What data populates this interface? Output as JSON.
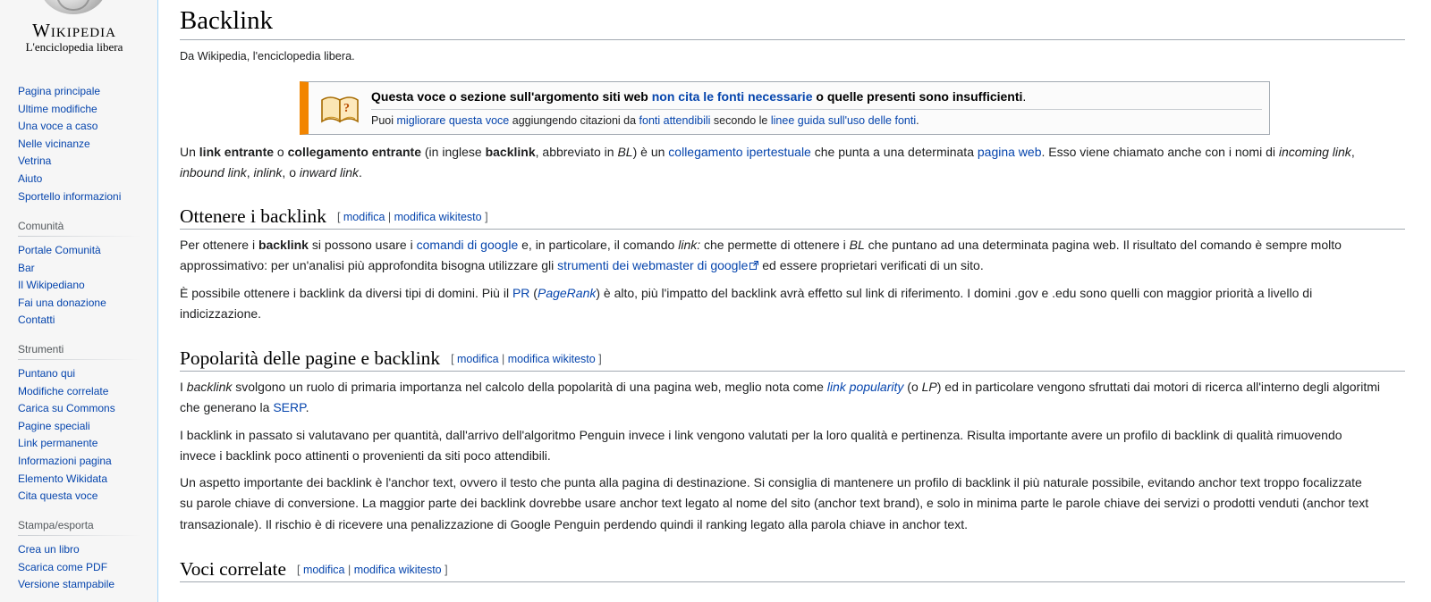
{
  "sidebar": {
    "logo": {
      "wordmark": "Wikipedia",
      "tagline": "L'enciclopedia libera"
    },
    "navigation": [
      "Pagina principale",
      "Ultime modifiche",
      "Una voce a caso",
      "Nelle vicinanze",
      "Vetrina",
      "Aiuto",
      "Sportello informazioni"
    ],
    "community": {
      "heading": "Comunità",
      "items": [
        "Portale Comunità",
        "Bar",
        "Il Wikipediano",
        "Fai una donazione",
        "Contatti"
      ]
    },
    "tools": {
      "heading": "Strumenti",
      "items": [
        "Puntano qui",
        "Modifiche correlate",
        "Carica su Commons",
        "Pagine speciali",
        "Link permanente",
        "Informazioni pagina",
        "Elemento Wikidata",
        "Cita questa voce"
      ]
    },
    "print": {
      "heading": "Stampa/esporta",
      "items": [
        "Crea un libro",
        "Scarica come PDF",
        "Versione stampabile"
      ]
    }
  },
  "article": {
    "title": "Backlink",
    "site_sub": "Da Wikipedia, l'enciclopedia libera.",
    "ambox": {
      "l1_a": "Questa voce o sezione sull'argomento siti web ",
      "l1_link": "non cita le fonti necessarie",
      "l1_b": " o quelle presenti sono insufficienti",
      "l1_end": ".",
      "l2_a": "Puoi ",
      "l2_link1": "migliorare questa voce",
      "l2_b": " aggiungendo citazioni da ",
      "l2_link2": "fonti attendibili",
      "l2_c": " secondo le ",
      "l2_link3": "linee guida sull'uso delle fonti",
      "l2_d": "."
    },
    "intro": {
      "t1": "Un ",
      "b1": "link entrante",
      "t2": " o ",
      "b2": "collegamento entrante",
      "t3": " (in inglese ",
      "b3": "backlink",
      "t4": ", abbreviato in ",
      "i1": "BL",
      "t5": ") è un ",
      "l1": "collegamento ipertestuale",
      "t6": " che punta a una determinata ",
      "l2": "pagina web",
      "t7": ". Esso viene chiamato anche con i nomi di ",
      "i2": "incoming link",
      "t8": ", ",
      "i3": "inbound link",
      "t9": ", ",
      "i4": "inlink",
      "t10": ", o ",
      "i5": "inward link",
      "t11": "."
    },
    "edit": {
      "open": "[ ",
      "modifica": "modifica",
      "sep": " | ",
      "wikitesto": "modifica wikitesto",
      "close": " ]"
    },
    "sections": {
      "ottenere": {
        "heading": "Ottenere i backlink",
        "p1": {
          "t1": "Per ottenere i ",
          "b1": "backlink",
          "t2": " si possono usare i ",
          "l1": "comandi di google",
          "t3": " e, in particolare, il comando ",
          "i1": "link:",
          "t4": " che permette di ottenere i ",
          "i2": "BL",
          "t5": " che puntano ad una determinata pagina web. Il risultato del comando è sempre molto approssimativo: per un'analisi più approfondita bisogna utilizzare gli ",
          "l2": "strumenti dei webmaster di google",
          "t6": " ed essere proprietari verificati di un sito."
        },
        "p2": {
          "t1": "È possibile ottenere i backlink da diversi tipi di domini. Più il ",
          "l1": "PR",
          "t2": " (",
          "l2": "PageRank",
          "t3": ") è alto, più l'impatto del backlink avrà effetto sul link di riferimento. I domini .gov e .edu sono quelli con maggior priorità a livello di indicizzazione."
        }
      },
      "popolarita": {
        "heading": "Popolarità delle pagine e backlink",
        "p1": {
          "t1": "I ",
          "i1": "backlink",
          "t2": " svolgono un ruolo di primaria importanza nel calcolo della popolarità di una pagina web, meglio nota come ",
          "l1": "link popularity",
          "t3": " (o ",
          "i2": "LP",
          "t4": ") ed in particolare vengono sfruttati dai motori di ricerca all'interno degli algoritmi che generano la ",
          "l2": "SERP",
          "t5": "."
        },
        "p2": "I backlink in passato si valutavano per quantità, dall'arrivo dell'algoritmo Penguin invece i link vengono valutati per la loro qualità e pertinenza. Risulta importante avere un profilo di backlink di qualità rimuovendo invece i backlink poco attinenti o provenienti da siti poco attendibili.",
        "p3": "Un aspetto importante dei backlink è l'anchor text, ovvero il testo che punta alla pagina di destinazione. Si consiglia di mantenere un profilo di backlink il più naturale possibile, evitando anchor text troppo focalizzate su parole chiave di conversione. La maggior parte dei backlink dovrebbe usare anchor text legato al nome del sito (anchor text brand), e solo in minima parte le parole chiave dei servizi o prodotti venduti (anchor text transazionale). Il rischio è di ricevere una penalizzazione di Google Penguin perdendo quindi il ranking legato alla parola chiave in anchor text."
      },
      "voci": {
        "heading": "Voci correlate"
      }
    }
  },
  "colors": {
    "link": "#0645ad",
    "ambox_border": "#f28500",
    "text": "#202122",
    "sidebar_bg": "#f6f6f6",
    "heading_rule": "#a2a9b1"
  },
  "icons": {
    "ambox": "book-question-icon",
    "external": "external-link-icon"
  }
}
